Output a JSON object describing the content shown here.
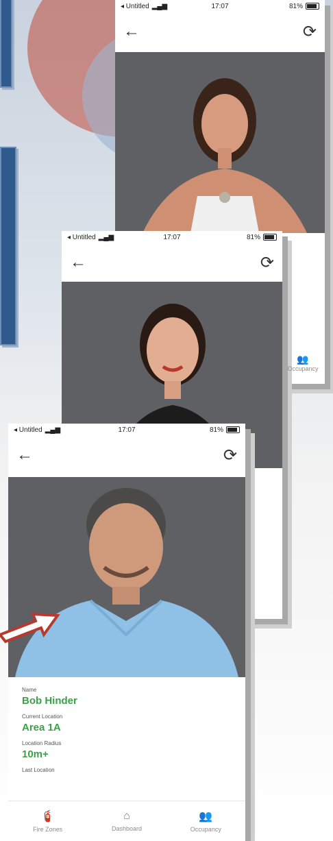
{
  "status_bar": {
    "carrier": "◂ Untitled",
    "time": "17:07",
    "battery": "81%"
  },
  "back_glyph": "←",
  "refresh_glyph": "⟳",
  "phone_mid": {
    "partial_tab_label": "Occupancy"
  },
  "profile": {
    "fields": [
      {
        "label": "Name",
        "value": "Bob Hinder"
      },
      {
        "label": "Current Location",
        "value": "Area 1A"
      },
      {
        "label": "Location Radius",
        "value": "10m+"
      },
      {
        "label": "Last Location",
        "value": ""
      }
    ]
  },
  "tabs": [
    {
      "label": "Fire Zones",
      "icon": "fire-extinguisher-icon"
    },
    {
      "label": "Dashboard",
      "icon": "home-icon"
    },
    {
      "label": "Occupancy",
      "icon": "people-icon"
    }
  ],
  "colors": {
    "accent_green": "#3aa147",
    "photo_bg": "#5f6063",
    "panel_blue": "#2f5a8e",
    "arrow_red": "#b7392f"
  }
}
